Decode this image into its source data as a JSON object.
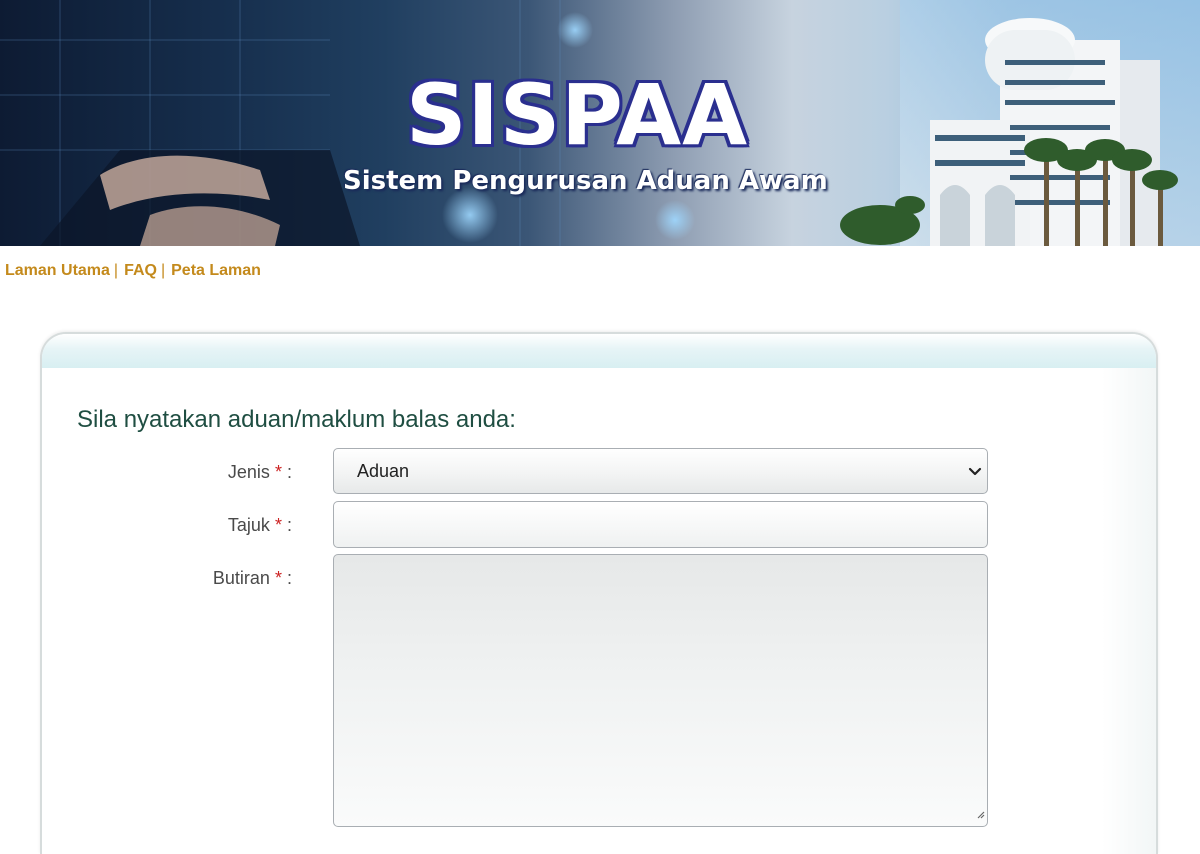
{
  "banner": {
    "title": "SISPAA",
    "subtitle": "Sistem Pengurusan Aduan Awam"
  },
  "nav": {
    "items": [
      "Laman Utama",
      "FAQ",
      "Peta Laman"
    ],
    "separator": "|"
  },
  "form": {
    "heading": "Sila nyatakan aduan/maklum balas anda:",
    "required_marker": "*",
    "colon": ":",
    "fields": {
      "jenis": {
        "label": "Jenis",
        "value": "Aduan"
      },
      "tajuk": {
        "label": "Tajuk",
        "value": ""
      },
      "butiran": {
        "label": "Butiran",
        "value": ""
      }
    }
  },
  "colors": {
    "nav_link": "#c48a1c",
    "heading": "#1f4e42",
    "required": "#cc2222",
    "title_outline": "#2a2f8f"
  },
  "icons": {
    "select_arrow": "chevron-down-icon",
    "resize": "resize-grip-icon"
  }
}
